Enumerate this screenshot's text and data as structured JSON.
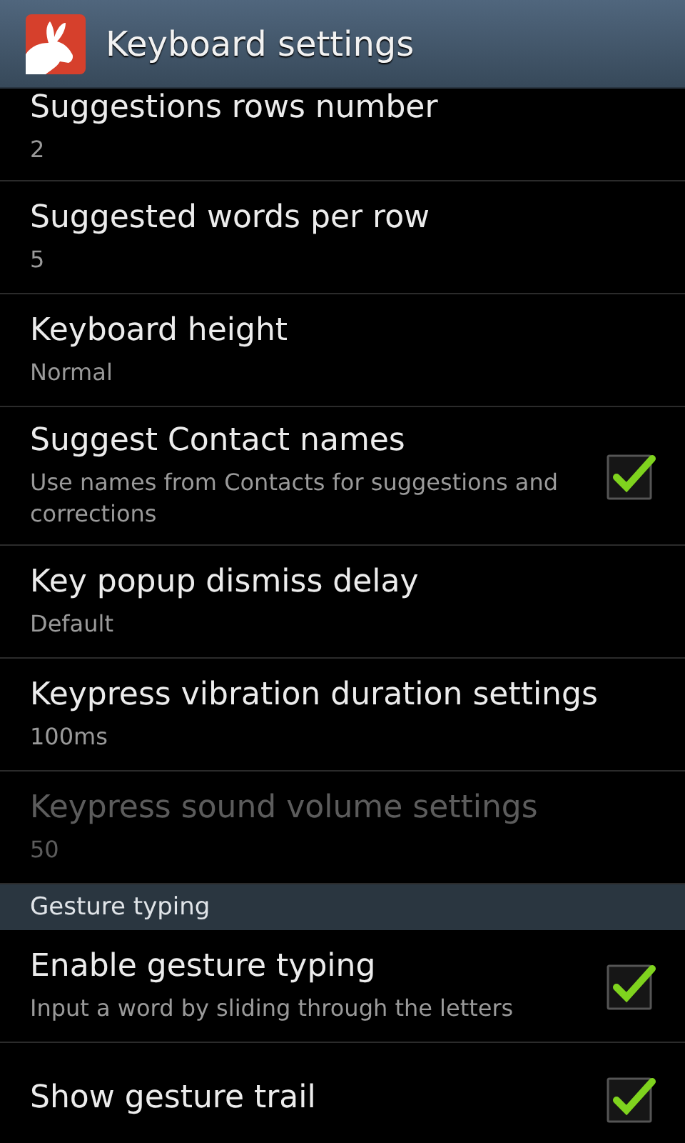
{
  "action_bar": {
    "title": "Keyboard settings"
  },
  "items": [
    {
      "kind": "value",
      "title": "Suggestions rows number",
      "summary": "2",
      "disabled": false
    },
    {
      "kind": "value",
      "title": "Suggested words per row",
      "summary": "5",
      "disabled": false
    },
    {
      "kind": "value",
      "title": "Keyboard height",
      "summary": "Normal",
      "disabled": false
    },
    {
      "kind": "check",
      "title": "Suggest Contact names",
      "summary": "Use names from Contacts for suggestions and corrections",
      "disabled": false,
      "checked": true
    },
    {
      "kind": "value",
      "title": "Key popup dismiss delay",
      "summary": "Default",
      "disabled": false
    },
    {
      "kind": "value",
      "title": "Keypress vibration duration settings",
      "summary": "100ms",
      "disabled": false
    },
    {
      "kind": "value",
      "title": "Keypress sound volume settings",
      "summary": "50",
      "disabled": true
    },
    {
      "kind": "header",
      "title": "Gesture typing"
    },
    {
      "kind": "check",
      "title": "Enable gesture typing",
      "summary": "Input a word by sliding through the letters",
      "disabled": false,
      "checked": true
    },
    {
      "kind": "check",
      "title": "Show gesture trail",
      "disabled": false,
      "checked": true
    }
  ]
}
